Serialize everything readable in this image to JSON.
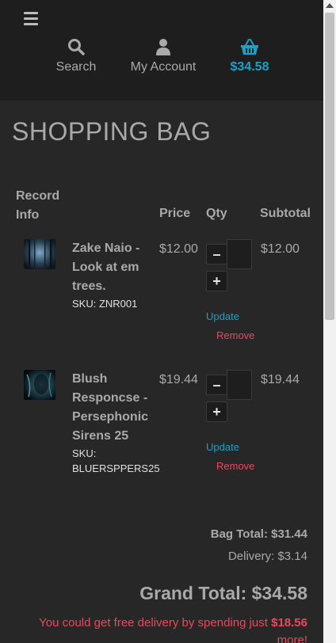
{
  "nav": {
    "search_label": "Search",
    "account_label": "My Account",
    "cart_total": "$34.58",
    "accent_color": "#1ba1c6"
  },
  "page": {
    "title": "SHOPPING BAG"
  },
  "table": {
    "headers": {
      "record_info_1": "Record",
      "record_info_2": "Info",
      "price": "Price",
      "qty": "Qty",
      "subtotal": "Subtotal"
    }
  },
  "items": [
    {
      "name_lines": [
        "Zake Naio -",
        "Look at em",
        "trees."
      ],
      "sku_lines": [
        "SKU: ZNR001"
      ],
      "price": "$12.00",
      "quantity": "",
      "subtotal": "$12.00",
      "minus": "–",
      "plus": "+",
      "update": "Update",
      "remove": "Remove"
    },
    {
      "name_lines": [
        "Blush",
        "Responcse -",
        "Persephonic",
        "Sirens 25"
      ],
      "sku_lines": [
        "SKU:",
        "BLUERSPPERS25"
      ],
      "price": "$19.44",
      "quantity": "",
      "subtotal": "$19.44",
      "minus": "–",
      "plus": "+",
      "update": "Update",
      "remove": "Remove"
    }
  ],
  "totals": {
    "bag_total": "Bag Total: $31.44",
    "delivery": "Delivery: $3.14",
    "grand_total": "Grand Total: $34.58"
  },
  "promo": {
    "prefix": "You could get free delivery by spending just ",
    "amount": "$18.56",
    "suffix": "more!",
    "color": "#e8495c"
  }
}
